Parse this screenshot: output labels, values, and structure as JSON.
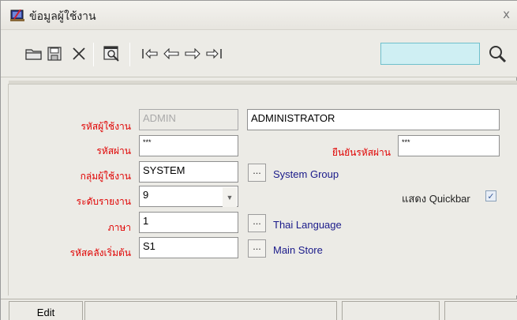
{
  "window": {
    "title": "ข้อมูลผู้ใช้งาน",
    "close_label": "x"
  },
  "toolbar": {
    "buttons": [
      {
        "name": "open-folder-icon"
      },
      {
        "name": "save-icon"
      },
      {
        "name": "delete-icon"
      },
      {
        "name": "preview-icon"
      },
      {
        "name": "first-record-icon"
      },
      {
        "name": "previous-record-icon"
      },
      {
        "name": "next-record-icon"
      },
      {
        "name": "last-record-icon"
      }
    ],
    "search_value": "",
    "search_icon": "magnifier-icon"
  },
  "form": {
    "user_code": {
      "label": "รหัสผู้ใช้งาน",
      "value": "ADMIN"
    },
    "user_name": {
      "value": "ADMINISTRATOR"
    },
    "password": {
      "label": "รหัสผ่าน",
      "value": "***"
    },
    "confirm_password": {
      "label": "ยืนยันรหัสผ่าน",
      "value": "***"
    },
    "user_group": {
      "label": "กลุ่มผู้ใช้งาน",
      "value": "SYSTEM",
      "lookup": "...",
      "description": "System Group"
    },
    "report_level": {
      "label": "ระดับรายงาน",
      "value": "9",
      "dropdown_icon": "chevron-down-icon"
    },
    "quickbar": {
      "label": "แสดง Quickbar",
      "checked": true,
      "mark": "✓"
    },
    "language": {
      "label": "ภาษา",
      "value": "1",
      "lookup": "...",
      "description": "Thai Language"
    },
    "default_store": {
      "label": "รหัสคลังเริ่มต้น",
      "value": "S1",
      "lookup": "...",
      "description": "Main Store"
    }
  },
  "statusbar": {
    "mode": "Edit",
    "panels": [
      "",
      "",
      "",
      ""
    ]
  }
}
